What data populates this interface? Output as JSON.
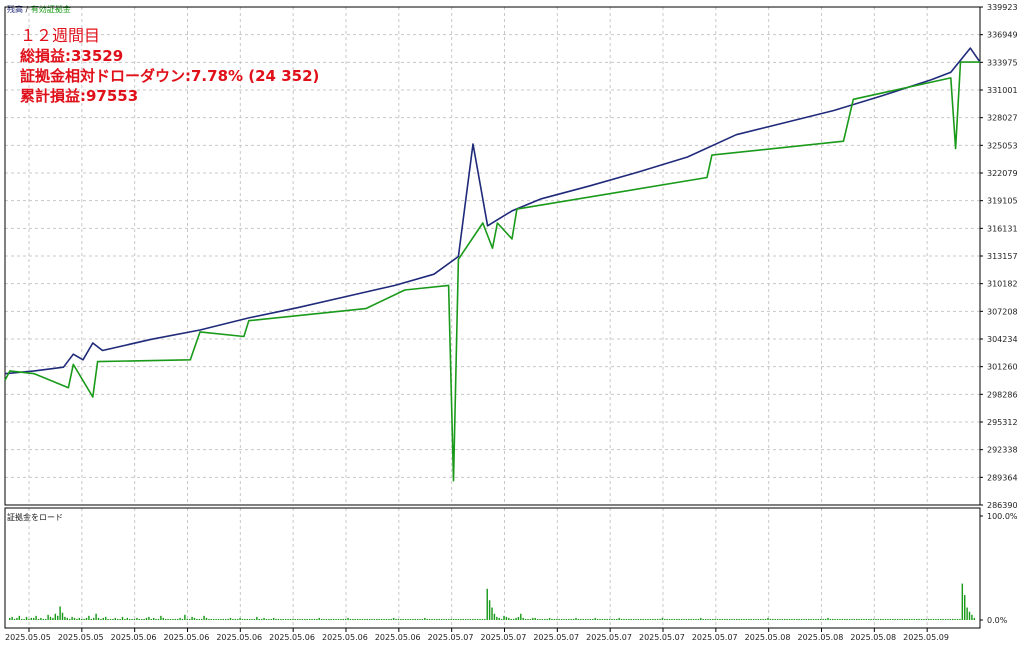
{
  "header": {
    "main_legend_balance": "残高",
    "main_legend_sep": " / ",
    "main_legend_equity": "有効証拠金",
    "sub_title": "証拠金をロード"
  },
  "summary": {
    "line1": "１２週間目",
    "line2": "総損益:33529",
    "line3": "証拠金相対ドローダウン:7.78% (24 352)",
    "line4": "累計損益:97553"
  },
  "colors": {
    "balance": "#1f2a7a",
    "equity": "#1a9a1a",
    "load_bars": "#1a9a1a",
    "summary_text": "#e0101a",
    "grid": "#c8c8c8"
  },
  "chart_data": [
    {
      "type": "line",
      "y_ticks": [
        "339923",
        "336949",
        "333975",
        "331001",
        "328027",
        "325053",
        "322079",
        "319105",
        "316131",
        "313157",
        "310182",
        "307208",
        "304234",
        "301260",
        "298286",
        "295312",
        "292338",
        "289364",
        "286390"
      ],
      "ylim": [
        286390,
        339923
      ],
      "xlim": [
        0,
        1
      ],
      "grid": true,
      "series": [
        {
          "role": "balance",
          "points": [
            [
              0,
              300500
            ],
            [
              0.03,
              300800
            ],
            [
              0.06,
              301200
            ],
            [
              0.07,
              302600
            ],
            [
              0.08,
              302000
            ],
            [
              0.09,
              303800
            ],
            [
              0.1,
              303000
            ],
            [
              0.15,
              304200
            ],
            [
              0.2,
              305200
            ],
            [
              0.25,
              306500
            ],
            [
              0.3,
              307600
            ],
            [
              0.35,
              308800
            ],
            [
              0.4,
              310000
            ],
            [
              0.44,
              311200
            ],
            [
              0.465,
              313100
            ],
            [
              0.48,
              325200
            ],
            [
              0.495,
              316400
            ],
            [
              0.52,
              318000
            ],
            [
              0.55,
              319300
            ],
            [
              0.6,
              320700
            ],
            [
              0.65,
              322200
            ],
            [
              0.7,
              323800
            ],
            [
              0.75,
              326200
            ],
            [
              0.8,
              327500
            ],
            [
              0.85,
              328800
            ],
            [
              0.9,
              330400
            ],
            [
              0.95,
              332100
            ],
            [
              0.97,
              332900
            ],
            [
              0.98,
              334200
            ],
            [
              0.99,
              335500
            ],
            [
              1.0,
              334000
            ]
          ]
        },
        {
          "role": "equity",
          "points": [
            [
              0,
              299800
            ],
            [
              0.005,
              300800
            ],
            [
              0.03,
              300500
            ],
            [
              0.065,
              299000
            ],
            [
              0.07,
              301500
            ],
            [
              0.09,
              298000
            ],
            [
              0.095,
              301800
            ],
            [
              0.19,
              302000
            ],
            [
              0.2,
              305000
            ],
            [
              0.245,
              304500
            ],
            [
              0.25,
              306200
            ],
            [
              0.37,
              307500
            ],
            [
              0.41,
              309500
            ],
            [
              0.455,
              310000
            ],
            [
              0.46,
              289000
            ],
            [
              0.465,
              312800
            ],
            [
              0.49,
              316700
            ],
            [
              0.5,
              314000
            ],
            [
              0.505,
              316700
            ],
            [
              0.52,
              315000
            ],
            [
              0.525,
              318200
            ],
            [
              0.72,
              321600
            ],
            [
              0.725,
              324000
            ],
            [
              0.86,
              325500
            ],
            [
              0.87,
              330000
            ],
            [
              0.97,
              332300
            ],
            [
              0.975,
              324700
            ],
            [
              0.98,
              334000
            ],
            [
              1.0,
              334000
            ]
          ]
        }
      ]
    },
    {
      "type": "bar",
      "y_ticks": [
        "100.0%",
        "0.0%"
      ],
      "ylim": [
        0,
        100
      ],
      "x_labels": [
        "2025.05.05",
        "2025.05.05",
        "2025.05.06",
        "2025.05.06",
        "2025.05.06",
        "2025.05.06",
        "2025.05.06",
        "2025.05.06",
        "2025.05.07",
        "2025.05.07",
        "2025.05.07",
        "2025.05.07",
        "2025.05.07",
        "2025.05.07",
        "2025.05.08",
        "2025.05.08",
        "2025.05.08",
        "2025.05.09"
      ],
      "values": [
        2,
        3,
        1,
        2,
        4,
        1,
        1,
        3,
        1,
        2,
        2,
        4,
        1,
        2,
        1,
        1,
        5,
        3,
        2,
        6,
        4,
        13,
        7,
        3,
        2,
        1,
        3,
        2,
        1,
        2,
        1,
        1,
        2,
        4,
        1,
        2,
        6,
        2,
        1,
        2,
        3,
        1,
        1,
        1,
        2,
        1,
        1,
        3,
        1,
        2,
        1,
        1,
        1,
        2,
        1,
        1,
        1,
        2,
        3,
        1,
        2,
        1,
        1,
        4,
        2,
        1,
        1,
        1,
        1,
        1,
        1,
        2,
        1,
        5,
        1,
        1,
        3,
        2,
        1,
        1,
        1,
        4,
        2,
        1,
        1,
        1,
        1,
        1,
        1,
        1,
        1,
        1,
        2,
        1,
        1,
        1,
        2,
        1,
        1,
        1,
        1,
        1,
        1,
        3,
        1,
        1,
        2,
        1,
        1,
        1,
        2,
        1,
        1,
        1,
        1,
        1,
        1,
        1,
        1,
        1,
        1,
        1,
        1,
        1,
        1,
        1,
        1,
        1,
        1,
        2,
        1,
        1,
        1,
        1,
        1,
        1,
        1,
        1,
        1,
        1,
        1,
        2,
        1,
        1,
        1,
        1,
        1,
        1,
        1,
        1,
        1,
        1,
        1,
        1,
        1,
        1,
        1,
        1,
        1,
        1,
        2,
        1,
        1,
        1,
        1,
        1,
        1,
        1,
        1,
        1,
        1,
        1,
        1,
        2,
        1,
        1,
        1,
        1,
        1,
        1,
        1,
        1,
        1,
        1,
        1,
        1,
        1,
        1,
        1,
        1,
        1,
        1,
        1,
        1,
        1,
        1,
        1,
        1,
        1,
        30,
        19,
        12,
        6,
        3,
        2,
        1,
        4,
        3,
        2,
        1,
        1,
        2,
        3,
        6,
        2,
        1,
        1,
        1,
        2,
        2,
        1,
        1,
        1,
        1,
        1,
        2,
        1,
        1,
        1,
        1,
        1,
        1,
        1,
        1,
        1,
        1,
        2,
        1,
        1,
        1,
        1,
        1,
        1,
        1,
        2,
        1,
        1,
        1,
        1,
        1,
        1,
        1,
        1,
        1,
        2,
        1,
        1,
        1,
        1,
        1,
        1,
        1,
        1,
        1,
        1,
        1,
        1,
        1,
        1,
        1,
        1,
        1,
        2,
        1,
        1,
        1,
        1,
        1,
        1,
        1,
        1,
        1,
        1,
        1,
        1,
        1,
        1,
        1,
        2,
        1,
        1,
        1,
        1,
        1,
        1,
        1,
        1,
        1,
        1,
        1,
        1,
        1,
        1,
        1,
        1,
        1,
        1,
        1,
        1,
        1,
        1,
        1,
        1,
        1,
        1,
        1,
        2,
        1,
        1,
        1,
        1,
        1,
        1,
        1,
        1,
        1,
        1,
        1,
        1,
        1,
        1,
        1,
        1,
        1,
        1,
        1,
        1,
        1,
        1,
        1,
        1,
        2,
        1,
        1,
        1,
        1,
        1,
        1,
        1,
        1,
        1,
        1,
        1,
        1,
        1,
        1,
        1,
        1,
        1,
        1,
        1,
        1,
        1,
        1,
        1,
        1,
        1,
        1,
        1,
        1,
        1,
        1,
        1,
        1,
        1,
        1,
        1,
        1,
        1,
        1,
        1,
        1,
        1,
        1,
        1,
        1,
        1,
        1,
        1,
        1,
        1,
        1,
        1,
        1,
        1,
        1,
        1,
        35,
        24,
        12,
        8,
        5,
        2
      ]
    }
  ]
}
